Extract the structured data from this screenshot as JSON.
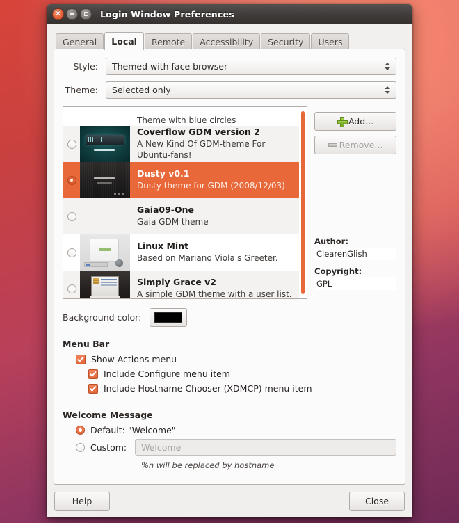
{
  "window": {
    "title": "Login Window Preferences",
    "controls": {
      "close": "close-button",
      "minimize": "minimize-button",
      "maximize": "maximize-button"
    }
  },
  "tabs": [
    {
      "label": "General",
      "active": false
    },
    {
      "label": "Local",
      "active": true
    },
    {
      "label": "Remote",
      "active": false
    },
    {
      "label": "Accessibility",
      "active": false
    },
    {
      "label": "Security",
      "active": false
    },
    {
      "label": "Users",
      "active": false
    }
  ],
  "fields": {
    "style_label": "Style:",
    "style_value": "Themed with face browser",
    "theme_label": "Theme:",
    "theme_value": "Selected only"
  },
  "theme_list": [
    {
      "name": "",
      "desc": "Theme with blue circles",
      "selected": false
    },
    {
      "name": "Coverflow GDM version 2",
      "desc": "A New Kind Of GDM-theme For Ubuntu-fans!",
      "selected": false
    },
    {
      "name": "Dusty v0.1",
      "desc": "Dusty theme for GDM (2008/12/03)",
      "selected": true
    },
    {
      "name": "Gaia09-One",
      "desc": "Gaia GDM theme",
      "selected": false
    },
    {
      "name": "Linux Mint",
      "desc": "Based on Mariano Viola's Greeter.",
      "selected": false
    },
    {
      "name": "Simply Grace v2",
      "desc": "A simple GDM theme with a user list.",
      "selected": false
    }
  ],
  "side": {
    "add_label": "Add...",
    "remove_label": "Remove...",
    "author_caption": "Author:",
    "author_value": "ClearenGlish",
    "copyright_caption": "Copyright:",
    "copyright_value": "GPL"
  },
  "background": {
    "label": "Background color:",
    "color": "#000000"
  },
  "menu_bar": {
    "title": "Menu Bar",
    "options": [
      {
        "label": "Show Actions menu",
        "checked": true
      },
      {
        "label": "Include Configure menu item",
        "checked": true
      },
      {
        "label": "Include Hostname Chooser (XDMCP) menu item",
        "checked": true
      }
    ]
  },
  "welcome": {
    "title": "Welcome Message",
    "default_label": "Default: \"Welcome\"",
    "default_selected": true,
    "custom_label": "Custom:",
    "custom_selected": false,
    "custom_value": "",
    "custom_placeholder": "Welcome",
    "hint": "%n will be replaced by hostname"
  },
  "actions": {
    "help_label": "Help",
    "close_label": "Close"
  },
  "colors": {
    "accent": "#e8683a",
    "titlebar": "#423e3d",
    "panel": "#fcfbfb"
  }
}
